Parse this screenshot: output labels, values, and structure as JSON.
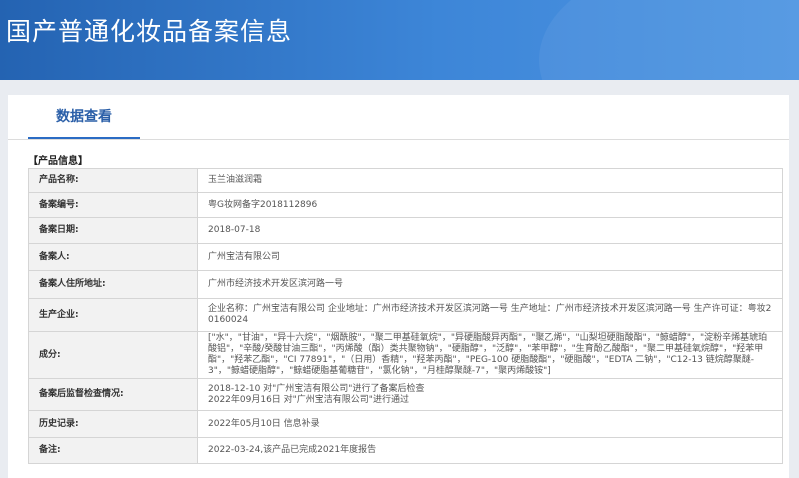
{
  "header": {
    "title": "国产普通化妆品备案信息"
  },
  "tabs": [
    {
      "label": "数据查看"
    }
  ],
  "section": {
    "label": "【产品信息】"
  },
  "rows": [
    {
      "key": "产品名称:",
      "value": "玉兰油滋润霜"
    },
    {
      "key": "备案编号:",
      "value": "粤G妆网备字2018112896"
    },
    {
      "key": "备案日期:",
      "value": "2018-07-18"
    },
    {
      "key": "备案人:",
      "value": "广州宝洁有限公司"
    },
    {
      "key": "备案人住所地址:",
      "value": "广州市经济技术开发区滨河路一号"
    },
    {
      "key": "生产企业:",
      "value": "企业名称：广州宝洁有限公司 企业地址：广州市经济技术开发区滨河路一号 生产地址：广州市经济技术开发区滨河路一号 生产许可证：粤妆20160024"
    },
    {
      "key": "成分:",
      "value": "[\"水\"，\"甘油\"，\"异十六烷\"，\"烟酰胺\"，\"聚二甲基硅氧烷\"，\"异硬脂酸异丙酯\"，\"聚乙烯\"，\"山梨坦硬脂酸酯\"，\"鲸蜡醇\"，\"淀粉辛烯基琥珀酸铝\"，\"辛酸/癸酸甘油三酯\"，\"丙烯酸（酯）类共聚物钠\"，\"硬脂醇\"，\"泛醇\"，\"苯甲醇\"，\"生育酚乙酸酯\"，\"聚二甲基硅氧烷醇\"，\"羟苯甲酯\"，\"羟苯乙酯\"，\"CI 77891\"，\"（日用）香精\"，\"羟苯丙酯\"，\"PEG-100 硬脂酸酯\"，\"硬脂酸\"，\"EDTA 二钠\"，\"C12-13 链烷醇聚醚-3\"，\"鲸蜡硬脂醇\"，\"鲸蜡硬脂基葡糖苷\"，\"氯化钠\"，\"月桂醇聚醚-7\"，\"聚丙烯酸铵\"]"
    },
    {
      "key": "备案后监督检查情况:",
      "value": "2018-12-10 对\"广州宝洁有限公司\"进行了备案后检查\n2022年09月16日 对\"广州宝洁有限公司\"进行通过"
    },
    {
      "key": "历史记录:",
      "value": "2022年05月10日 信息补录"
    },
    {
      "key": "备注:",
      "value": "2022-03-24,该产品已完成2021年度报告"
    }
  ]
}
